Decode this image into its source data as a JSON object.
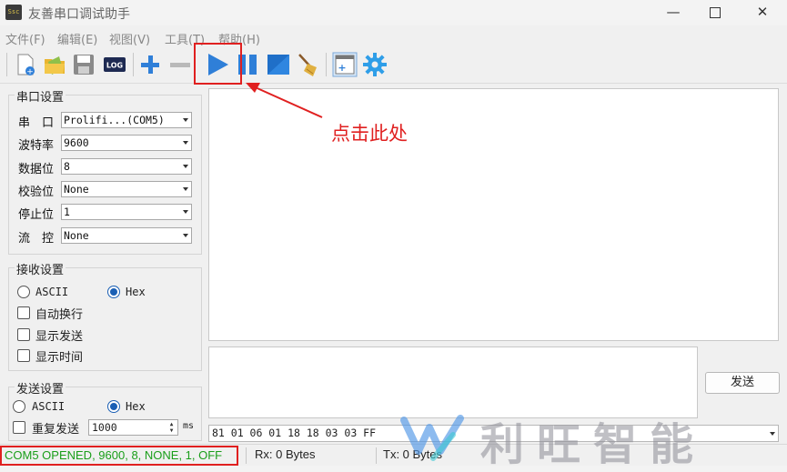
{
  "window": {
    "title": "友善串口调试助手",
    "icon_text": "Ssc",
    "controls": [
      "minimize-icon",
      "maximize-icon",
      "close-icon"
    ]
  },
  "menu": [
    "文件(F)",
    "编辑(E)",
    "视图(V)",
    "工具(T)",
    "帮助(H)"
  ],
  "toolbar": {
    "icons": [
      "new-file-icon",
      "open-folder-icon",
      "save-icon",
      "log-icon",
      "add-icon",
      "remove-icon",
      "start-icon",
      "pause-icon",
      "stop-icon",
      "clear-broom-icon",
      "new-window-icon",
      "settings-gear-icon"
    ],
    "log_label": "LOG"
  },
  "serial_settings": {
    "title": "串口设置",
    "rows": [
      {
        "label": "串　口",
        "value": "Prolifi...(COM5)"
      },
      {
        "label": "波特率",
        "value": "9600"
      },
      {
        "label": "数据位",
        "value": "8"
      },
      {
        "label": "校验位",
        "value": "None"
      },
      {
        "label": "停止位",
        "value": "1"
      },
      {
        "label": "流　控",
        "value": "None"
      }
    ]
  },
  "receive_settings": {
    "title": "接收设置",
    "ascii_label": "ASCII",
    "hex_label": "Hex",
    "selected": "Hex",
    "checkboxes": [
      "自动换行",
      "显示发送",
      "显示时间"
    ]
  },
  "send_settings": {
    "title": "发送设置",
    "ascii_label": "ASCII",
    "hex_label": "Hex",
    "selected": "Hex",
    "repeat_label": "重复发送",
    "repeat_interval": "1000",
    "unit": "ms"
  },
  "send_panel": {
    "send_button": "发送",
    "hex_data": "81 01 06 01 18 18 03 03 FF"
  },
  "status": {
    "port_status": "COM5 OPENED, 9600, 8, NONE, 1, OFF",
    "rx": "Rx: 0 Bytes",
    "tx": "Tx: 0 Bytes"
  },
  "annotation": {
    "text": "点击此处",
    "color": "#e02020"
  },
  "watermark": {
    "text": "利旺智能"
  },
  "colors": {
    "accent_blue": "#1a5fb4",
    "status_green": "#1a9e1a",
    "highlight_red": "#e02020"
  }
}
